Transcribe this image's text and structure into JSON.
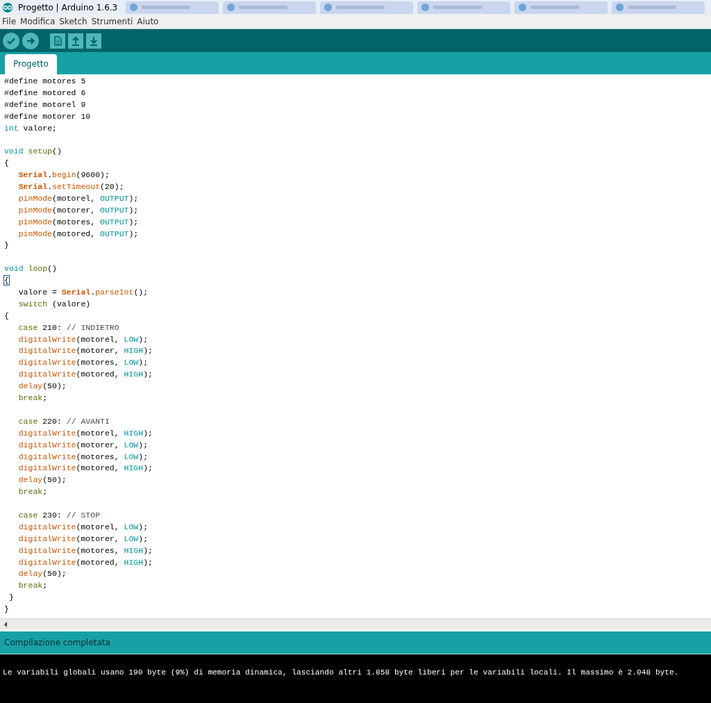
{
  "window": {
    "title": "Progetto | Arduino 1.6.3"
  },
  "menu": [
    "File",
    "Modifica",
    "Sketch",
    "Strumenti",
    "Aiuto"
  ],
  "toolbar": [
    {
      "kind": "verify"
    },
    {
      "kind": "upload"
    },
    {
      "kind": "new"
    },
    {
      "kind": "open"
    },
    {
      "kind": "save"
    }
  ],
  "tabs": [
    {
      "label": "Progetto",
      "selected": true
    }
  ],
  "code_lines": [
    {
      "kind": "code",
      "tokens": [
        {
          "text": "#define motores 5",
          "kind": "plain"
        }
      ]
    },
    {
      "kind": "code",
      "tokens": [
        {
          "text": "#define motored 6",
          "kind": "plain"
        }
      ]
    },
    {
      "kind": "code",
      "tokens": [
        {
          "text": "#define motorel 9",
          "kind": "plain"
        }
      ]
    },
    {
      "kind": "code",
      "tokens": [
        {
          "text": "#define motorer 10",
          "kind": "plain"
        }
      ]
    },
    {
      "kind": "code",
      "tokens": [
        {
          "text": "int",
          "kind": "type"
        },
        {
          "text": " valore;",
          "kind": "plain"
        }
      ]
    },
    {
      "kind": "blank"
    },
    {
      "kind": "code",
      "tokens": [
        {
          "text": "void",
          "kind": "type"
        },
        {
          "text": " setup",
          "kind": "olive"
        },
        {
          "text": "()",
          "kind": "plain"
        }
      ]
    },
    {
      "kind": "code",
      "tokens": [
        {
          "text": "{",
          "kind": "plain"
        }
      ]
    },
    {
      "kind": "indented",
      "tokens": [
        {
          "text": "Serial",
          "kind": "serial"
        },
        {
          "text": ".",
          "kind": "plain"
        },
        {
          "text": "begin",
          "kind": "func"
        },
        {
          "text": "(9600);",
          "kind": "plain"
        }
      ]
    },
    {
      "kind": "indented",
      "tokens": [
        {
          "text": "Serial",
          "kind": "serial"
        },
        {
          "text": ".",
          "kind": "plain"
        },
        {
          "text": "setTimeout",
          "kind": "func"
        },
        {
          "text": "(20);",
          "kind": "plain"
        }
      ]
    },
    {
      "kind": "indented",
      "tokens": [
        {
          "text": "pinMode",
          "kind": "func"
        },
        {
          "text": "(motorel, ",
          "kind": "plain"
        },
        {
          "text": "OUTPUT",
          "kind": "const"
        },
        {
          "text": ");",
          "kind": "plain"
        }
      ]
    },
    {
      "kind": "indented",
      "tokens": [
        {
          "text": "pinMode",
          "kind": "func"
        },
        {
          "text": "(motorer, ",
          "kind": "plain"
        },
        {
          "text": "OUTPUT",
          "kind": "const"
        },
        {
          "text": ");",
          "kind": "plain"
        }
      ]
    },
    {
      "kind": "indented",
      "tokens": [
        {
          "text": "pinMode",
          "kind": "func"
        },
        {
          "text": "(motores, ",
          "kind": "plain"
        },
        {
          "text": "OUTPUT",
          "kind": "const"
        },
        {
          "text": ");",
          "kind": "plain"
        }
      ]
    },
    {
      "kind": "indented",
      "tokens": [
        {
          "text": "pinMode",
          "kind": "func"
        },
        {
          "text": "(motored, ",
          "kind": "plain"
        },
        {
          "text": "OUTPUT",
          "kind": "const"
        },
        {
          "text": ");",
          "kind": "plain"
        }
      ]
    },
    {
      "kind": "code",
      "tokens": [
        {
          "text": "}",
          "kind": "plain"
        }
      ]
    },
    {
      "kind": "blank"
    },
    {
      "kind": "code",
      "tokens": [
        {
          "text": "void",
          "kind": "type"
        },
        {
          "text": " loop",
          "kind": "olive"
        },
        {
          "text": "()",
          "kind": "plain"
        }
      ]
    },
    {
      "kind": "code",
      "tokens": [
        {
          "text": "{",
          "kind": "match"
        }
      ]
    },
    {
      "kind": "indented",
      "tokens": [
        {
          "text": "valore = ",
          "kind": "plain"
        },
        {
          "text": "Serial",
          "kind": "serial"
        },
        {
          "text": ".",
          "kind": "plain"
        },
        {
          "text": "parseInt",
          "kind": "func"
        },
        {
          "text": "();",
          "kind": "plain"
        }
      ]
    },
    {
      "kind": "indented",
      "tokens": [
        {
          "text": "switch",
          "kind": "olive"
        },
        {
          "text": " (valore)",
          "kind": "plain"
        }
      ]
    },
    {
      "kind": "code",
      "tokens": [
        {
          "text": "{",
          "kind": "plain"
        }
      ]
    },
    {
      "kind": "indented",
      "tokens": [
        {
          "text": "case",
          "kind": "olive"
        },
        {
          "text": " 210: ",
          "kind": "plain"
        },
        {
          "text": "// INDIETRO",
          "kind": "comment"
        }
      ]
    },
    {
      "kind": "indented",
      "tokens": [
        {
          "text": "digitalWrite",
          "kind": "func"
        },
        {
          "text": "(motorel, ",
          "kind": "plain"
        },
        {
          "text": "LOW",
          "kind": "const"
        },
        {
          "text": ");",
          "kind": "plain"
        }
      ]
    },
    {
      "kind": "indented",
      "tokens": [
        {
          "text": "digitalWrite",
          "kind": "func"
        },
        {
          "text": "(motorer, ",
          "kind": "plain"
        },
        {
          "text": "HIGH",
          "kind": "const"
        },
        {
          "text": ");",
          "kind": "plain"
        }
      ]
    },
    {
      "kind": "indented",
      "tokens": [
        {
          "text": "digitalWrite",
          "kind": "func"
        },
        {
          "text": "(motores, ",
          "kind": "plain"
        },
        {
          "text": "LOW",
          "kind": "const"
        },
        {
          "text": ");",
          "kind": "plain"
        }
      ]
    },
    {
      "kind": "indented",
      "tokens": [
        {
          "text": "digitalWrite",
          "kind": "func"
        },
        {
          "text": "(motored, ",
          "kind": "plain"
        },
        {
          "text": "HIGH",
          "kind": "const"
        },
        {
          "text": ");",
          "kind": "plain"
        }
      ]
    },
    {
      "kind": "indented",
      "tokens": [
        {
          "text": "delay",
          "kind": "func"
        },
        {
          "text": "(50);",
          "kind": "plain"
        }
      ]
    },
    {
      "kind": "indented",
      "tokens": [
        {
          "text": "break",
          "kind": "olive"
        },
        {
          "text": ";",
          "kind": "plain"
        }
      ]
    },
    {
      "kind": "blank"
    },
    {
      "kind": "indented",
      "tokens": [
        {
          "text": "case",
          "kind": "olive"
        },
        {
          "text": " 220: ",
          "kind": "plain"
        },
        {
          "text": "// AVANTI",
          "kind": "comment"
        }
      ]
    },
    {
      "kind": "indented",
      "tokens": [
        {
          "text": "digitalWrite",
          "kind": "func"
        },
        {
          "text": "(motorel, ",
          "kind": "plain"
        },
        {
          "text": "HIGH",
          "kind": "const"
        },
        {
          "text": ");",
          "kind": "plain"
        }
      ]
    },
    {
      "kind": "indented",
      "tokens": [
        {
          "text": "digitalWrite",
          "kind": "func"
        },
        {
          "text": "(motorer, ",
          "kind": "plain"
        },
        {
          "text": "LOW",
          "kind": "const"
        },
        {
          "text": ");",
          "kind": "plain"
        }
      ]
    },
    {
      "kind": "indented",
      "tokens": [
        {
          "text": "digitalWrite",
          "kind": "func"
        },
        {
          "text": "(motores, ",
          "kind": "plain"
        },
        {
          "text": "LOW",
          "kind": "const"
        },
        {
          "text": ");",
          "kind": "plain"
        }
      ]
    },
    {
      "kind": "indented",
      "tokens": [
        {
          "text": "digitalWrite",
          "kind": "func"
        },
        {
          "text": "(motored, ",
          "kind": "plain"
        },
        {
          "text": "HIGH",
          "kind": "const"
        },
        {
          "text": ");",
          "kind": "plain"
        }
      ]
    },
    {
      "kind": "indented",
      "tokens": [
        {
          "text": "delay",
          "kind": "func"
        },
        {
          "text": "(50);",
          "kind": "plain"
        }
      ]
    },
    {
      "kind": "indented",
      "tokens": [
        {
          "text": "break",
          "kind": "olive"
        },
        {
          "text": ";",
          "kind": "plain"
        }
      ]
    },
    {
      "kind": "blank"
    },
    {
      "kind": "indented",
      "tokens": [
        {
          "text": "case",
          "kind": "olive"
        },
        {
          "text": " 230: ",
          "kind": "plain"
        },
        {
          "text": "// STOP",
          "kind": "comment"
        }
      ]
    },
    {
      "kind": "indented",
      "tokens": [
        {
          "text": "digitalWrite",
          "kind": "func"
        },
        {
          "text": "(motorel, ",
          "kind": "plain"
        },
        {
          "text": "LOW",
          "kind": "const"
        },
        {
          "text": ");",
          "kind": "plain"
        }
      ]
    },
    {
      "kind": "indented",
      "tokens": [
        {
          "text": "digitalWrite",
          "kind": "func"
        },
        {
          "text": "(motorer, ",
          "kind": "plain"
        },
        {
          "text": "LOW",
          "kind": "const"
        },
        {
          "text": ");",
          "kind": "plain"
        }
      ]
    },
    {
      "kind": "indented",
      "tokens": [
        {
          "text": "digitalWrite",
          "kind": "func"
        },
        {
          "text": "(motores, ",
          "kind": "plain"
        },
        {
          "text": "HIGH",
          "kind": "const"
        },
        {
          "text": ");",
          "kind": "plain"
        }
      ]
    },
    {
      "kind": "indented",
      "tokens": [
        {
          "text": "digitalWrite",
          "kind": "func"
        },
        {
          "text": "(motored, ",
          "kind": "plain"
        },
        {
          "text": "HIGH",
          "kind": "const"
        },
        {
          "text": ");",
          "kind": "plain"
        }
      ]
    },
    {
      "kind": "indented",
      "tokens": [
        {
          "text": "delay",
          "kind": "func"
        },
        {
          "text": "(50);",
          "kind": "plain"
        }
      ]
    },
    {
      "kind": "indented",
      "tokens": [
        {
          "text": "break",
          "kind": "olive"
        },
        {
          "text": ";",
          "kind": "plain"
        }
      ]
    },
    {
      "kind": "half_indented",
      "tokens": [
        {
          "text": "}",
          "kind": "plain"
        }
      ]
    },
    {
      "kind": "code",
      "tokens": [
        {
          "text": "}",
          "kind": "plain"
        }
      ]
    }
  ],
  "status_bar": "Compilazione completata",
  "console": [
    "Le variabili globali usano 190 byte (9%) di memoria dinamica, lasciando altri 1.858 byte liberi per le variabili locali. Il massimo è 2.048 byte."
  ]
}
